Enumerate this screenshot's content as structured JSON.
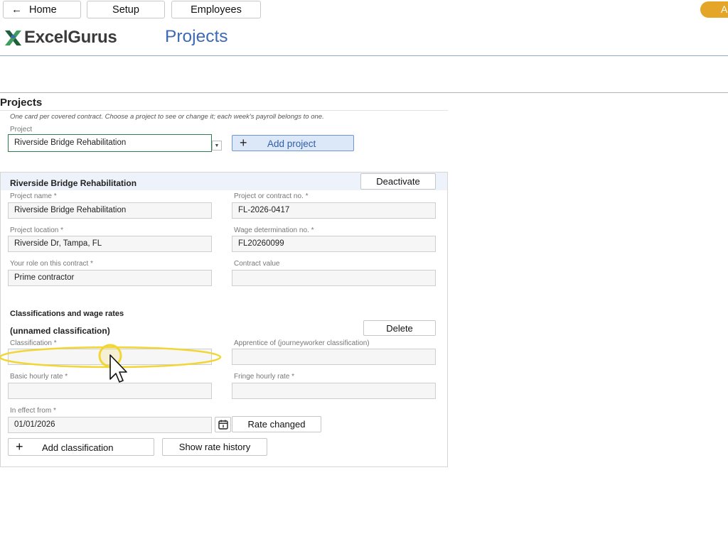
{
  "nav": {
    "home_arrow": "←",
    "home_label": "Home",
    "setup_label": "Setup",
    "employees_label": "Employees",
    "account_initial": "A"
  },
  "brand": {
    "name": "ExcelGurus"
  },
  "page": {
    "title": "Projects"
  },
  "projects_section": {
    "title": "Projects",
    "hint": "One card per covered contract. Choose a project to see or change it; each week's payroll belongs to one.",
    "project_label": "Project",
    "selected_project": "Riverside Bridge Rehabilitation",
    "add_project_plus": "+",
    "add_project_label": "Add project"
  },
  "card": {
    "title": "Riverside Bridge Rehabilitation",
    "deactivate_label": "Deactivate",
    "fields": {
      "project_name": {
        "label": "Project name *",
        "value": "Riverside Bridge Rehabilitation"
      },
      "contract_no": {
        "label": "Project or contract no. *",
        "value": "FL-2026-0417"
      },
      "location": {
        "label": "Project location *",
        "value": "Riverside Dr, Tampa, FL"
      },
      "wage_determination": {
        "label": "Wage determination no. *",
        "value": "FL20260099"
      },
      "role": {
        "label": "Your role on this contract *",
        "value": "Prime contractor"
      },
      "contract_value": {
        "label": "Contract value",
        "value": ""
      }
    },
    "classifications": {
      "title": "Classifications and wage rates",
      "item_title": "(unnamed classification)",
      "delete_label": "Delete",
      "classification": {
        "label": "Classification *",
        "value": ""
      },
      "apprentice_of": {
        "label": "Apprentice of (journeyworker classification)",
        "value": ""
      },
      "basic_rate": {
        "label": "Basic hourly rate *",
        "value": ""
      },
      "fringe_rate": {
        "label": "Fringe hourly rate *",
        "value": ""
      },
      "effective": {
        "label": "In effect from *",
        "value": "01/01/2026"
      },
      "rate_changed_label": "Rate changed",
      "add_classification_plus": "+",
      "add_classification_label": "Add classification",
      "show_history_label": "Show rate history"
    }
  },
  "colors": {
    "brand_blue": "#3d6ab3",
    "accent_green": "#2f7d4f",
    "account_orange": "#e5a528",
    "highlight_yellow": "#f2d635"
  }
}
